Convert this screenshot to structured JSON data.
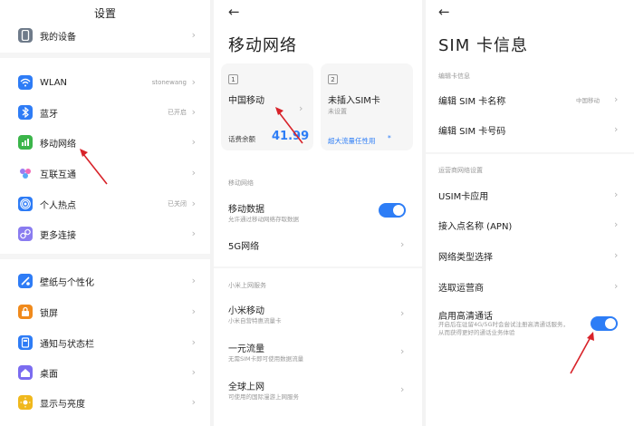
{
  "settings": {
    "title": "设置",
    "items": [
      {
        "label": "我的设备",
        "value": "",
        "icon": "phone-icon",
        "color": "#6f7b8a"
      },
      {
        "label": "WLAN",
        "value": "stonewang",
        "icon": "wifi-icon",
        "color": "#2e7cf6"
      },
      {
        "label": "蓝牙",
        "value": "已开启",
        "icon": "bluetooth-icon",
        "color": "#2e7cf6"
      },
      {
        "label": "移动网络",
        "value": "",
        "icon": "cellular-icon",
        "color": "#3bb54a"
      },
      {
        "label": "互联互通",
        "value": "",
        "icon": "interconnect-icon",
        "color": "#9b7cf0"
      },
      {
        "label": "个人热点",
        "value": "已关闭",
        "icon": "hotspot-icon",
        "color": "#2e7cf6"
      },
      {
        "label": "更多连接",
        "value": "",
        "icon": "link-icon",
        "color": "#8a7cf0"
      },
      {
        "label": "壁纸与个性化",
        "value": "",
        "icon": "wallpaper-icon",
        "color": "#2e7cf6"
      },
      {
        "label": "锁屏",
        "value": "",
        "icon": "lock-icon",
        "color": "#f08a1c"
      },
      {
        "label": "通知与状态栏",
        "value": "",
        "icon": "notification-icon",
        "color": "#2e7cf6"
      },
      {
        "label": "桌面",
        "value": "",
        "icon": "home-icon",
        "color": "#7b6cf0"
      },
      {
        "label": "显示与亮度",
        "value": "",
        "icon": "brightness-icon",
        "color": "#f0b81c"
      }
    ]
  },
  "mobile_network": {
    "title": "移动网络",
    "sim1": {
      "slot": "1",
      "carrier": "中国移动",
      "balance_label": "话费余额",
      "balance_value": "41.99"
    },
    "sim2": {
      "slot": "2",
      "status": "未插入SIM卡",
      "sub": "未设置",
      "promo": "超大流量任性用",
      "promo_mark": "*"
    },
    "section1": "移动网络",
    "mobile_data": {
      "label": "移动数据",
      "sub": "允许通过移动网络存取数据",
      "on": true
    },
    "five_g": "5G网络",
    "section2": "小米上网服务",
    "xiaomi_mobile": {
      "label": "小米移动",
      "sub": "小米自营特惠流量卡"
    },
    "one_yuan": {
      "label": "一元流量",
      "sub": "无需SIM卡即可使用数据流量"
    },
    "global": {
      "label": "全球上网",
      "sub": "可使用的国际漫游上网服务"
    }
  },
  "sim_info": {
    "title": "SIM 卡信息",
    "section1": "编辑卡信息",
    "edit_name": {
      "label": "编辑 SIM 卡名称",
      "value": "中国移动"
    },
    "edit_number": "编辑 SIM 卡号码",
    "section2": "运营商网络设置",
    "usim": "USIM卡应用",
    "apn": "接入点名称 (APN)",
    "net_type": "网络类型选择",
    "carrier_select": "选取运营商",
    "hd_call": {
      "label": "启用高清通话",
      "sub": "开启后在驻留4G/5G时会尝试注册高清通话服务，从而获得更好的通话业务体验",
      "on": true
    }
  },
  "colors": {
    "accent": "#2d7df6",
    "arrow": "#d8232a"
  }
}
